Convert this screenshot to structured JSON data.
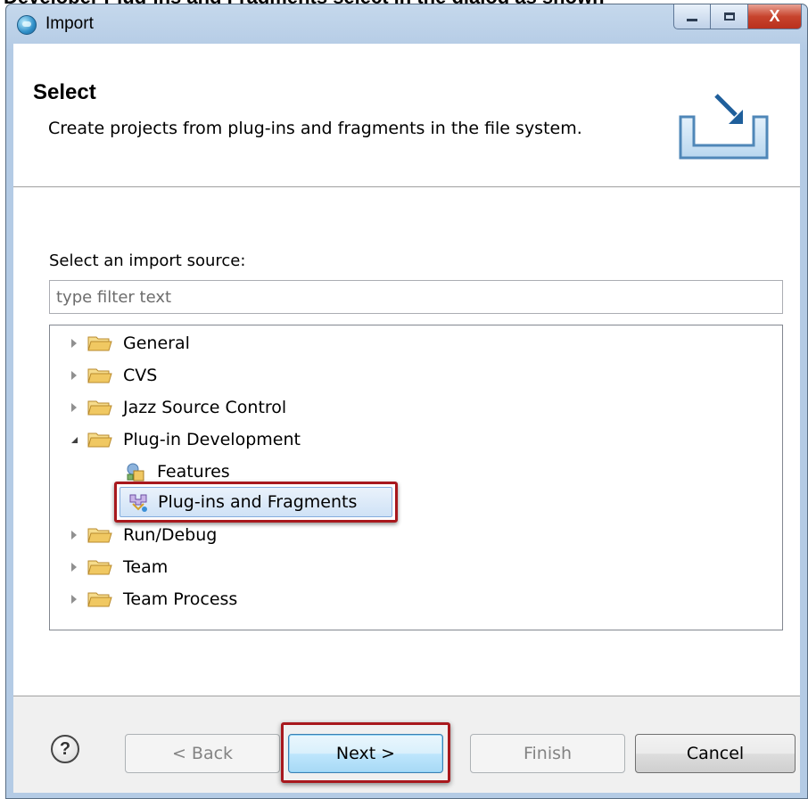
{
  "window": {
    "title": "Import"
  },
  "window_buttons": {
    "close_glyph": "X"
  },
  "top_strip_text": "Developer Plug-ins and Fragments select in the dialog as shown",
  "header": {
    "title": "Select",
    "description": "Create projects from plug-ins and fragments in the file system."
  },
  "body": {
    "source_label": "Select an import source:",
    "filter_placeholder": "type filter text",
    "tree": [
      {
        "label": "General",
        "type": "folder",
        "expanded": false
      },
      {
        "label": "CVS",
        "type": "folder",
        "expanded": false
      },
      {
        "label": "Jazz Source Control",
        "type": "folder",
        "expanded": false
      },
      {
        "label": "Plug-in Development",
        "type": "folder",
        "expanded": true
      },
      {
        "label": "Features",
        "type": "features-item",
        "level": 1
      },
      {
        "label": "Plug-ins and Fragments",
        "type": "plugins-item",
        "level": 1,
        "selected": true
      },
      {
        "label": "Run/Debug",
        "type": "folder",
        "expanded": false
      },
      {
        "label": "Team",
        "type": "folder",
        "expanded": false
      },
      {
        "label": "Team Process",
        "type": "folder",
        "expanded": false
      }
    ]
  },
  "footer": {
    "help_glyph": "?",
    "back": "< Back",
    "next": "Next >",
    "finish": "Finish",
    "cancel": "Cancel"
  },
  "colors": {
    "highlight_border": "#a8181d",
    "folder": "#f0c862",
    "selection": "#cfe2f6"
  }
}
